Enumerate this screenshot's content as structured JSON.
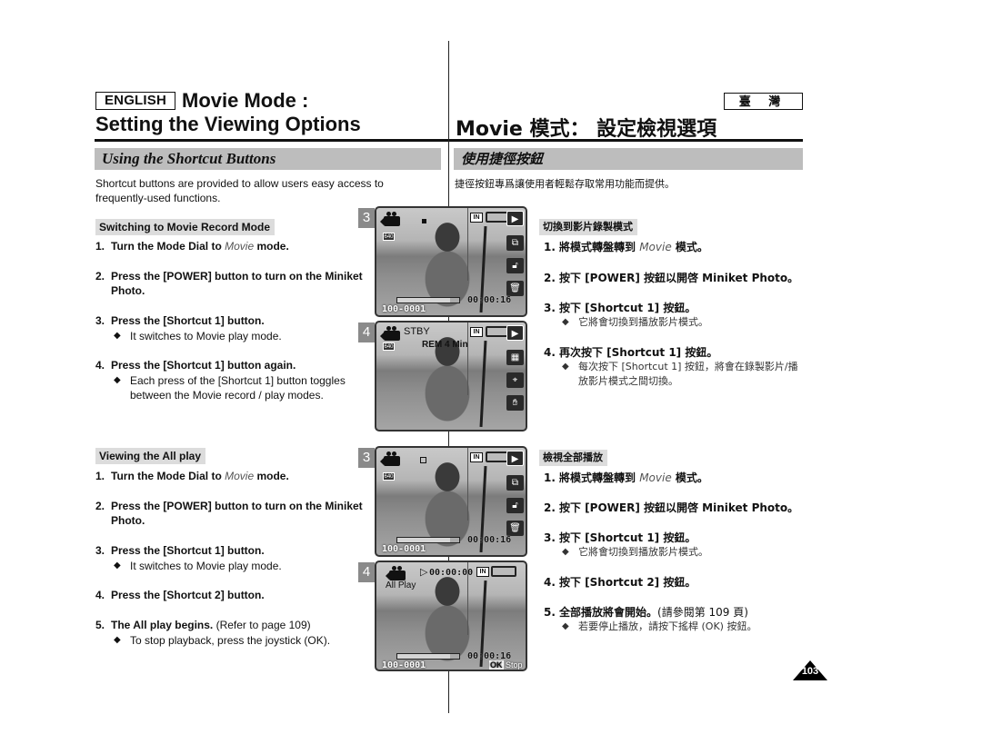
{
  "header": {
    "language_en": "ENGLISH",
    "title_line1": "Movie Mode :",
    "title_line2": "Setting the Viewing Options",
    "language_tw": "臺 灣",
    "title_tw": "Movie 模式： 設定檢視選項"
  },
  "section": {
    "title_en": "Using the Shortcut Buttons",
    "title_tw": "使用捷徑按鈕",
    "intro_en": "Shortcut buttons are provided to allow users easy access to frequently-used functions.",
    "intro_tw": "捷徑按鈕專爲讓使用者輕鬆存取常用功能而提供。"
  },
  "record_mode": {
    "heading_en": "Switching to Movie Record Mode",
    "heading_tw": "切換到影片錄製模式",
    "steps_en": [
      {
        "num": "1.",
        "pre": "Turn the Mode Dial to ",
        "em": "Movie",
        "post": " mode."
      },
      {
        "num": "2.",
        "text": "Press the [POWER] button to turn on the Miniket Photo."
      },
      {
        "num": "3.",
        "text": "Press the [Shortcut 1] button.",
        "bullet": "It switches to Movie play mode."
      },
      {
        "num": "4.",
        "text": "Press the [Shortcut 1] button again.",
        "bullet": "Each press of the [Shortcut 1] button toggles between the Movie record / play modes."
      }
    ],
    "steps_tw": [
      {
        "num": "1.",
        "pre": "將模式轉盤轉到 ",
        "em": "Movie",
        "post": " 模式。"
      },
      {
        "num": "2.",
        "text": "按下 [POWER] 按鈕以開啓 Miniket Photo。"
      },
      {
        "num": "3.",
        "text": "按下 [Shortcut 1] 按鈕。",
        "bullet": "它將會切換到播放影片模式。"
      },
      {
        "num": "4.",
        "text": "再次按下 [Shortcut 1] 按鈕。",
        "bullet": "每次按下 [Shortcut 1] 按鈕，將會在錄製影片/播放影片模式之間切換。"
      }
    ],
    "screens": [
      {
        "badge": "3",
        "file": "100-0001",
        "time": "00:00:16",
        "in": "IN",
        "res": "640",
        "progress": 0.85
      },
      {
        "badge": "4",
        "status": "STBY",
        "rem": "REM 4 Min",
        "in": "IN",
        "res": "640"
      }
    ]
  },
  "all_play": {
    "heading_en": "Viewing the All play",
    "heading_tw": "檢視全部播放",
    "steps_en": [
      {
        "num": "1.",
        "pre": "Turn the Mode Dial to ",
        "em": "Movie",
        "post": " mode."
      },
      {
        "num": "2.",
        "text": "Press the [POWER] button to turn on the Miniket Photo."
      },
      {
        "num": "3.",
        "text": "Press the [Shortcut 1] button.",
        "bullet": "It switches to Movie play mode."
      },
      {
        "num": "4.",
        "text": "Press the [Shortcut 2] button."
      },
      {
        "num": "5.",
        "text": "The All play begins.",
        "note": " (Refer to page 109)",
        "bullet": "To stop playback, press the joystick (OK)."
      }
    ],
    "steps_tw": [
      {
        "num": "1.",
        "pre": "將模式轉盤轉到 ",
        "em": "Movie",
        "post": " 模式。"
      },
      {
        "num": "2.",
        "text": "按下 [POWER] 按鈕以開啓 Miniket Photo。"
      },
      {
        "num": "3.",
        "text": "按下 [Shortcut 1] 按鈕。",
        "bullet": "它將會切換到播放影片模式。"
      },
      {
        "num": "4.",
        "text": "按下 [Shortcut 2] 按鈕。"
      },
      {
        "num": "5.",
        "text": "全部播放將會開始。",
        "note": "(請參閱第 109 頁)",
        "bullet": "若要停止播放，請按下搖桿 (OK) 按鈕。"
      }
    ],
    "screens": [
      {
        "badge": "3",
        "file": "100-0001",
        "time": "00:00:16",
        "in": "IN",
        "res": "640",
        "progress": 0.85
      },
      {
        "badge": "4",
        "mode_label": "All Play",
        "play_time": "00:00:00",
        "file": "100-0001",
        "time": "00:00:16",
        "in": "IN",
        "ok_label": "OK",
        "stop_label": "Stop",
        "progress": 0.85
      }
    ]
  },
  "page_number": "103"
}
